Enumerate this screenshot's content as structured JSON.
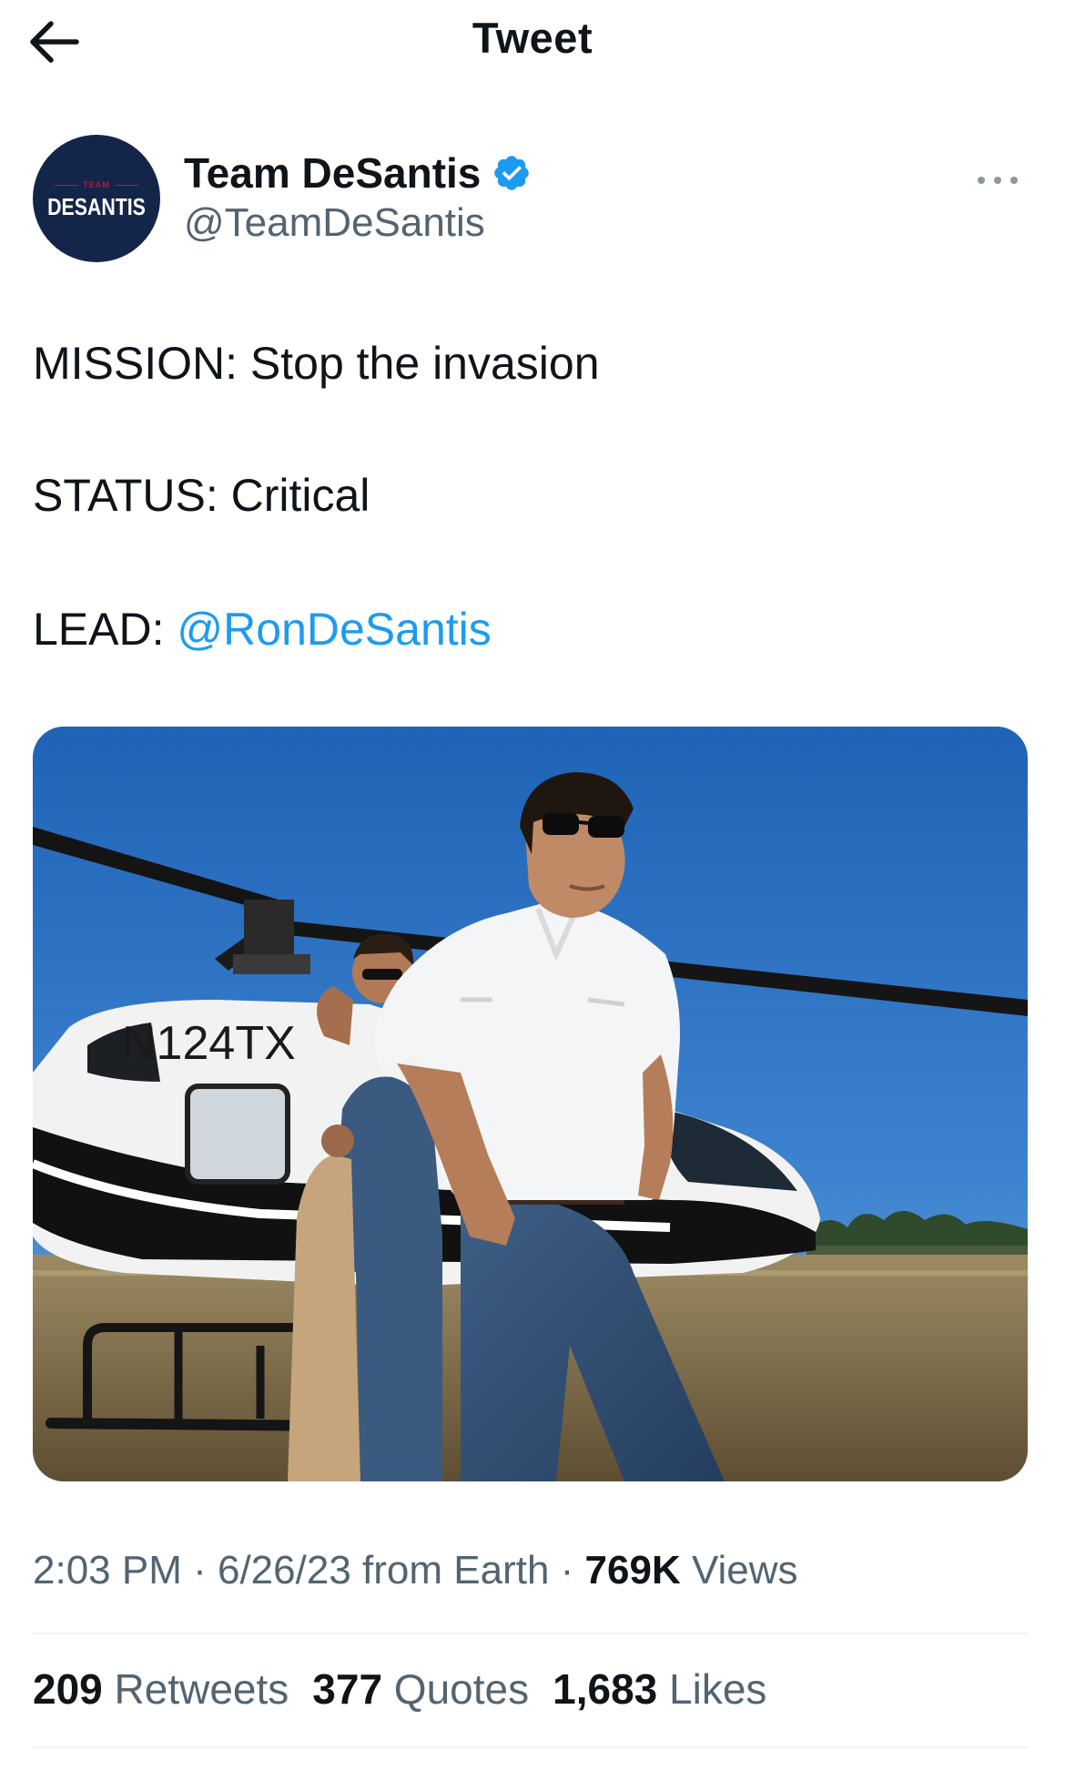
{
  "topbar": {
    "title": "Tweet"
  },
  "author": {
    "display_name": "Team DeSantis",
    "handle": "@TeamDeSantis",
    "avatar_top_text": "TEAM",
    "avatar_main_text": "DESANTIS",
    "verified": true
  },
  "tweet": {
    "line1": "MISSION: Stop the invasion",
    "line2": "STATUS: Critical",
    "line3_prefix": "LEAD: ",
    "line3_mention": "@RonDeSantis"
  },
  "media": {
    "tail_number": "N124TX"
  },
  "meta": {
    "time": "2:03 PM",
    "sep1": " · ",
    "date": "6/26/23",
    "source": " from Earth",
    "sep2": " · ",
    "views_count": "769K",
    "views_label": " Views"
  },
  "stats": {
    "retweets_count": "209",
    "retweets_label": " Retweets",
    "quotes_count": "377",
    "quotes_label": " Quotes",
    "likes_count": "1,683",
    "likes_label": " Likes"
  },
  "colors": {
    "link": "#1d9bf0",
    "secondary_text": "#536471",
    "primary_text": "#0f1419",
    "avatar_bg": "#14254a",
    "verified": "#1d9bf0"
  },
  "icons": [
    "arrow-left-icon",
    "verified-badge-icon",
    "more-dots-icon"
  ]
}
